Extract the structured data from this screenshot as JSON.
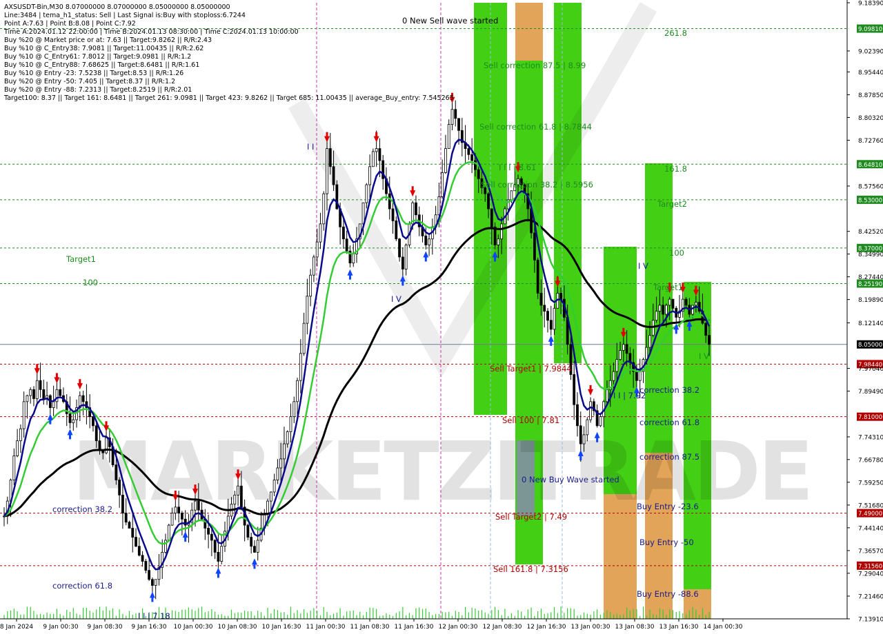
{
  "header": {
    "lines": [
      "AXSUSDT-Bin,M30  8.07000000 8.07000000 8.05000000 8.05000000",
      "Line:3484 | tema_h1_status: Sell | Last Signal is:Buy with stoploss:6.7244",
      "Point A:7.63 | Point B:8.08 | Point C:7.92",
      "Time A:2024.01.12 22:00:00 | Time B:2024.01.13 08:30:00 | Time C:2024.01.13 10:00:00",
      "Buy %20 @ Market price or at: 7.63 || Target:9.8262 || R/R:2.43",
      "Buy %10 @ C_Entry38: 7.9081 || Target:11.00435 || R/R:2.62",
      "Buy %10 @ C_Entry61: 7.8012 || Target:9.0981 || R/R:1.2",
      "Buy %10 @ C_Entry88: 7.68625 || Target:8.6481 || R/R:1.61",
      "Buy %10 @ Entry -23: 7.5238 || Target:8.53 || R/R:1.26",
      "Buy %20 @ Entry -50: 7.405 || Target:8.37 || R/R:1.2",
      "Buy %20 @ Entry -88: 7.2313 || Target:8.2519 || R/R:2.01",
      "Target100: 8.37 || Target 161: 8.6481 || Target 261: 9.0981 || Target 423: 9.8262 || Target 685: 11.00435 || average_Buy_entry: 7.545265"
    ]
  },
  "watermark": "MARKETZITRADE",
  "colors": {
    "green_zone": "#33cc00",
    "orange_zone": "#f0a060",
    "slate_zone": "#8090a0",
    "ma_blue": "#0a0a8c",
    "ma_green": "#33cc33",
    "ma_black": "#000000",
    "sell_arrow": "#e00000",
    "buy_arrow": "#1044ff",
    "level_green": "#1f8a1f",
    "level_red": "#b00000"
  },
  "chart_data": {
    "type": "candlestick",
    "symbol": "AXSUSDT-Bin",
    "timeframe": "M30",
    "ylim": [
      7.1391,
      9.1839
    ],
    "y_ticks": [
      "9.18390",
      "9.02390",
      "8.95440",
      "8.87850",
      "8.80320",
      "8.72760",
      "8.57560",
      "8.42520",
      "8.34990",
      "8.27440",
      "8.19890",
      "8.12140",
      "7.97040",
      "7.89490",
      "7.74310",
      "7.66780",
      "7.59250",
      "7.51680",
      "7.44140",
      "7.36570",
      "7.29040",
      "7.21460",
      "7.13910"
    ],
    "current_price": "8.05000",
    "x_ticks": [
      "8 Jan 2024",
      "9 Jan 00:30",
      "9 Jan 08:30",
      "9 Jan 16:30",
      "10 Jan 00:30",
      "10 Jan 08:30",
      "10 Jan 16:30",
      "11 Jan 00:30",
      "11 Jan 08:30",
      "11 Jan 16:30",
      "12 Jan 00:30",
      "12 Jan 08:30",
      "12 Jan 16:30",
      "13 Jan 00:30",
      "13 Jan 08:30",
      "13 Jan 16:30",
      "14 Jan 00:30"
    ],
    "levels": [
      {
        "value": 9.0981,
        "label": "9.09810",
        "kind": "target"
      },
      {
        "value": 8.6481,
        "label": "8.64810",
        "kind": "target"
      },
      {
        "value": 8.53,
        "label": "8.53000",
        "kind": "target"
      },
      {
        "value": 8.37,
        "label": "8.37000",
        "kind": "target"
      },
      {
        "value": 8.2519,
        "label": "8.25190",
        "kind": "target"
      },
      {
        "value": 7.98448,
        "label": "7.98440",
        "kind": "sell"
      },
      {
        "value": 7.81,
        "label": "7.81000",
        "kind": "sell"
      },
      {
        "value": 7.49,
        "label": "7.49000",
        "kind": "sell"
      },
      {
        "value": 7.3156,
        "label": "7.31560",
        "kind": "sell"
      }
    ],
    "annotations": [
      {
        "text": "0 New Sell wave started",
        "color": "#000000"
      },
      {
        "text": "261.8",
        "color": "#1f8a1f"
      },
      {
        "text": "Sell correction 87.5 | 8.99",
        "color": "#1f8a1f"
      },
      {
        "text": "Sell correction 61.8 | 8.7844",
        "color": "#1f8a1f"
      },
      {
        "text": "Sell correction 38.2 | 8.5956",
        "color": "#1f8a1f"
      },
      {
        "text": "I I I | 8.61",
        "color": "#1f8a1f"
      },
      {
        "text": "161.8",
        "color": "#1f8a1f"
      },
      {
        "text": "Target2",
        "color": "#1f8a1f"
      },
      {
        "text": "100",
        "color": "#1f8a1f"
      },
      {
        "text": "Target1",
        "color": "#1f8a1f"
      },
      {
        "text": "Target1",
        "color": "#1f8a1f"
      },
      {
        "text": "100",
        "color": "#1f8a1f"
      },
      {
        "text": "I V",
        "color": "#1f8a1f"
      },
      {
        "text": "I I",
        "color": "#1a1a8c"
      },
      {
        "text": "I V",
        "color": "#1a1a8c"
      },
      {
        "text": "I V",
        "color": "#1a1a8c"
      },
      {
        "text": "Sell Target1 | 7.9844",
        "color": "#b00000"
      },
      {
        "text": "Sell 100 | 7.81",
        "color": "#b00000"
      },
      {
        "text": "Sell Target2 | 7.49",
        "color": "#b00000"
      },
      {
        "text": "Sell 161.8 | 7.3156",
        "color": "#b00000"
      },
      {
        "text": "0 New Buy Wave started",
        "color": "#1a1a8c"
      },
      {
        "text": "I I I | 7.92",
        "color": "#1a1a8c"
      },
      {
        "text": "correction 38.2",
        "color": "#1a1a8c"
      },
      {
        "text": "correction 61.8",
        "color": "#1a1a8c"
      },
      {
        "text": "correction 87.5",
        "color": "#1a1a8c"
      },
      {
        "text": "Buy Entry -23.6",
        "color": "#1a1a8c"
      },
      {
        "text": "Buy Entry -50",
        "color": "#1a1a8c"
      },
      {
        "text": "Buy Entry -88.6",
        "color": "#1a1a8c"
      },
      {
        "text": "correction 38.2",
        "color": "#1a1a8c"
      },
      {
        "text": "correction 61.8",
        "color": "#1a1a8c"
      },
      {
        "text": "I I I 7.18",
        "color": "#1a1a8c"
      }
    ],
    "series": [
      {
        "key": "close",
        "values": [
          7.48,
          7.53,
          7.6,
          7.68,
          7.73,
          7.77,
          7.86,
          7.88,
          7.9,
          7.87,
          7.93,
          7.9,
          7.87,
          7.88,
          7.84,
          7.86,
          7.9,
          7.88,
          7.86,
          7.82,
          7.79,
          7.8,
          7.84,
          7.88,
          7.86,
          7.84,
          7.81,
          7.78,
          7.73,
          7.7,
          7.69,
          7.74,
          7.71,
          7.65,
          7.6,
          7.55,
          7.49,
          7.46,
          7.44,
          7.41,
          7.38,
          7.35,
          7.33,
          7.3,
          7.27,
          7.25,
          7.27,
          7.31,
          7.36,
          7.4,
          7.45,
          7.49,
          7.51,
          7.49,
          7.47,
          7.45,
          7.46,
          7.5,
          7.53,
          7.5,
          7.47,
          7.44,
          7.42,
          7.4,
          7.36,
          7.33,
          7.38,
          7.43,
          7.48,
          7.52,
          7.55,
          7.58,
          7.51,
          7.45,
          7.41,
          7.38,
          7.36,
          7.4,
          7.44,
          7.49,
          7.53,
          7.56,
          7.6,
          7.64,
          7.67,
          7.72,
          7.76,
          7.81,
          7.86,
          7.93,
          8.02,
          8.12,
          8.21,
          8.28,
          8.34,
          8.39,
          8.45,
          8.55,
          8.7,
          8.64,
          8.58,
          8.5,
          8.44,
          8.4,
          8.36,
          8.32,
          8.35,
          8.4,
          8.45,
          8.52,
          8.58,
          8.64,
          8.69,
          8.7,
          8.66,
          8.6,
          8.55,
          8.5,
          8.46,
          8.4,
          8.34,
          8.3,
          8.38,
          8.45,
          8.52,
          8.48,
          8.44,
          8.41,
          8.38,
          8.4,
          8.44,
          8.48,
          8.54,
          8.62,
          8.7,
          8.78,
          8.83,
          8.8,
          8.76,
          8.72,
          8.7,
          8.68,
          8.66,
          8.63,
          8.6,
          8.57,
          8.55,
          8.5,
          8.44,
          8.38,
          8.4,
          8.45,
          8.5,
          8.53,
          8.56,
          8.58,
          8.6,
          8.58,
          8.55,
          8.5,
          8.42,
          8.33,
          8.22,
          8.18,
          8.16,
          8.13,
          8.1,
          8.17,
          8.22,
          8.2,
          8.14,
          8.05,
          7.95,
          7.85,
          7.78,
          7.72,
          7.75,
          7.8,
          7.86,
          7.83,
          7.78,
          7.81,
          7.86,
          7.9,
          7.93,
          7.96,
          8.0,
          8.03,
          8.05,
          8.02,
          7.99,
          7.96,
          7.93,
          7.96,
          8.0,
          8.04,
          8.08,
          8.13,
          8.16,
          8.18,
          8.15,
          8.18,
          8.2,
          8.17,
          8.14,
          8.16,
          8.2,
          8.18,
          8.15,
          8.18,
          8.19,
          8.16,
          8.12,
          8.08,
          8.05
        ]
      },
      {
        "key": "fast_ma"
      },
      {
        "key": "slow_ma"
      },
      {
        "key": "long_ma"
      }
    ]
  }
}
